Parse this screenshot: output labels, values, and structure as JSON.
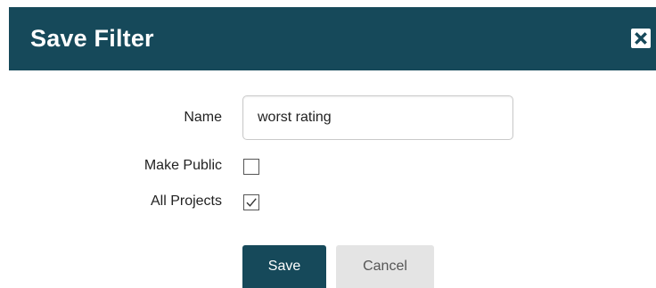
{
  "dialog": {
    "title": "Save Filter",
    "close_icon": "close-icon",
    "accent_color": "#16495a"
  },
  "form": {
    "name_label": "Name",
    "name_value": "worst rating",
    "make_public_label": "Make Public",
    "make_public_checked": false,
    "all_projects_label": "All Projects",
    "all_projects_checked": true
  },
  "buttons": {
    "save_label": "Save",
    "cancel_label": "Cancel"
  }
}
